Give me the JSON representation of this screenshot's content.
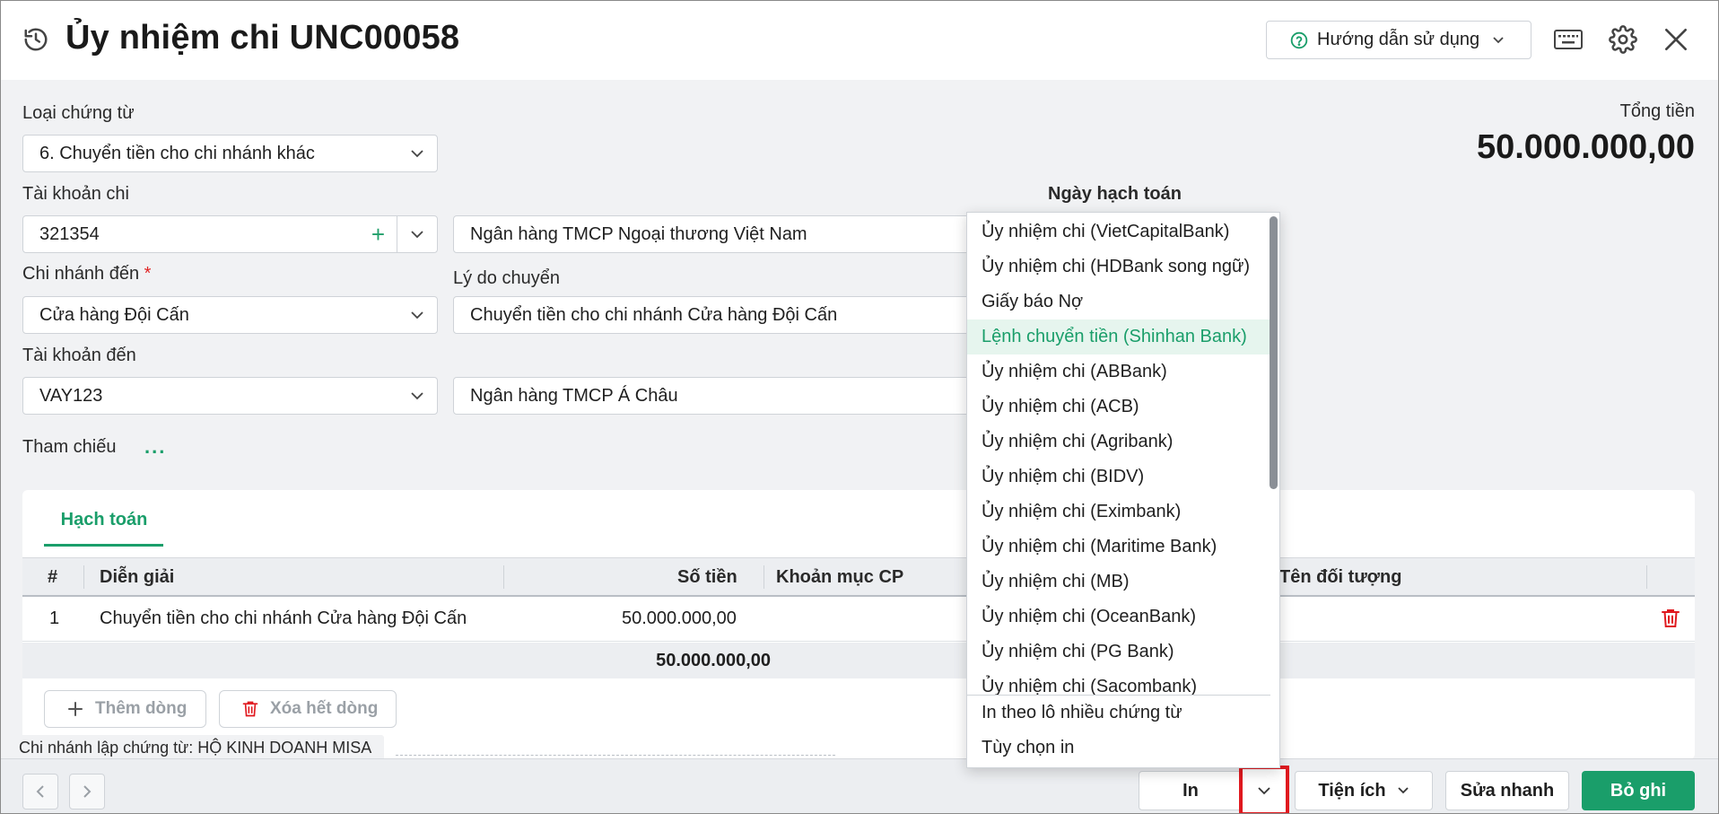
{
  "header": {
    "title": "Ủy nhiệm chi UNC00058",
    "help_label": "Hướng dẫn sử dụng"
  },
  "form": {
    "voucher_type_label": "Loại chứng từ",
    "voucher_type_value": "6. Chuyển tiền cho chi nhánh khác",
    "total_label": "Tổng tiền",
    "total_value": "50.000.000,00",
    "pay_account_label": "Tài khoản chi",
    "pay_account_value": "321354",
    "pay_bank_value": "Ngân hàng TMCP Ngoại thương Việt Nam",
    "posting_date_label": "Ngày hạch toán",
    "branch_to_label": "Chi nhánh đến",
    "required_mark": "*",
    "branch_to_value": "Cửa hàng Đội Cấn",
    "reason_label": "Lý do chuyển",
    "reason_value": "Chuyển tiền cho chi nhánh Cửa hàng Đội Cấn",
    "dest_account_label": "Tài khoản đến",
    "dest_account_value": "VAY123",
    "dest_bank_value": "Ngân hàng TMCP Á Châu",
    "reference_label": "Tham chiếu",
    "reference_dots": "..."
  },
  "detail": {
    "tab_label": "Hạch toán",
    "columns": {
      "index": "#",
      "description": "Diễn giải",
      "amount": "Số tiền",
      "cost_item": "Khoản mục CP",
      "object_name": "Tên đối tượng"
    },
    "rows": [
      {
        "index": "1",
        "description": "Chuyển tiền cho chi nhánh Cửa hàng Đội Cấn",
        "amount": "50.000.000,00"
      }
    ],
    "sum_amount": "50.000.000,00",
    "add_row_label": "Thêm dòng",
    "clear_rows_label": "Xóa hết dòng"
  },
  "branch_note": "Chi nhánh lập chứng từ: HỘ KINH DOANH MISA",
  "footer": {
    "print_label": "In",
    "utilities_label": "Tiện ích",
    "quick_edit_label": "Sửa nhanh",
    "unpost_label": "Bỏ ghi"
  },
  "print_menu": {
    "items": [
      "Ủy nhiệm chi (VietCapitalBank)",
      "Ủy nhiệm chi (HDBank song ngữ)",
      "Giấy báo Nợ",
      "Lệnh chuyển tiền (Shinhan Bank)",
      "Ủy nhiệm chi (ABBank)",
      "Ủy nhiệm chi (ACB)",
      "Ủy nhiệm chi (Agribank)",
      "Ủy nhiệm chi (BIDV)",
      "Ủy nhiệm chi (Eximbank)",
      "Ủy nhiệm chi (Maritime Bank)",
      "Ủy nhiệm chi (MB)",
      "Ủy nhiệm chi (OceanBank)",
      "Ủy nhiệm chi (PG Bank)",
      "Ủy nhiệm chi (Sacombank)"
    ],
    "active_index": 3,
    "batch_print_label": "In theo lô nhiều chứng từ",
    "print_options_label": "Tùy chọn in"
  },
  "colors": {
    "accent_green": "#1a9e6a",
    "danger_red": "#e0191f",
    "background_gray": "#f1f2f4"
  }
}
